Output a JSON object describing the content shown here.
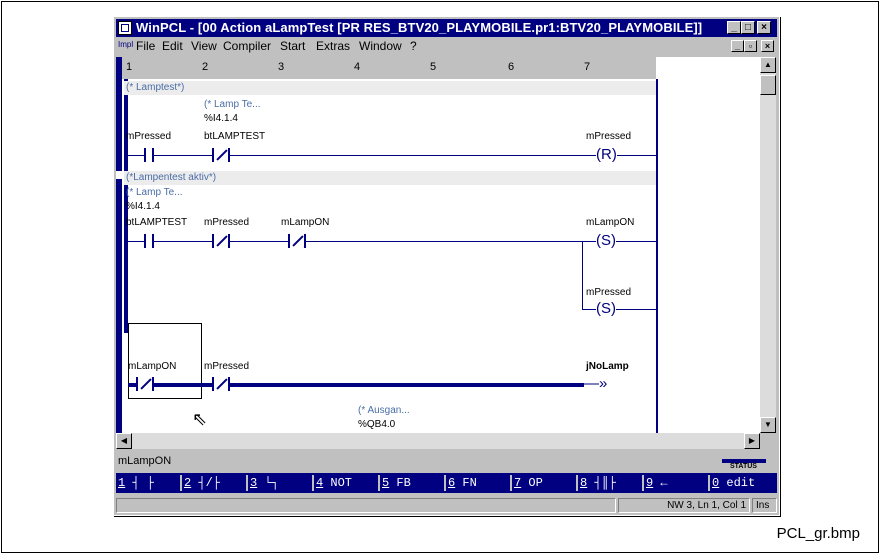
{
  "window": {
    "title": "WinPCL - [00 Action aLampTest [PR RES_BTV20_PLAYMOBILE.pr1:BTV20_PLAYMOBILE]]",
    "caption_buttons": [
      "minimize-icon",
      "maximize-icon",
      "close-icon"
    ]
  },
  "menubar": {
    "impl": "Impl",
    "items": [
      "File",
      "Edit",
      "View",
      "Compiler",
      "Start",
      "Extras",
      "Window",
      "?"
    ]
  },
  "columns": [
    "1",
    "2",
    "3",
    "4",
    "5",
    "6",
    "7"
  ],
  "network": {
    "comment1": "(* Lamptest*)",
    "n1_note": "(* Lamp Te...",
    "n1_addr": "%I4.1.4",
    "n1_c1": "mPressed",
    "n1_c2": "btLAMPTEST",
    "n1_coil": "mPressed",
    "n1_coil_symbol": "(R)",
    "comment2": "(*Lampentest aktiv*)",
    "n2_note": "(* Lamp Te...",
    "n2_addr": "%I4.1.4",
    "n2_c1": "btLAMPTEST",
    "n2_c2": "mPressed",
    "n2_c3": "mLampON",
    "n2_coil1": "mLampON",
    "n2_coil1_symbol": "(S)",
    "n2_coil2": "mPressed",
    "n2_coil2_symbol": "(S)",
    "n3_c1": "mLampON",
    "n3_c2": "mPressed",
    "n3_jump": "jNoLamp",
    "n3_jump_symbol": "—»",
    "n3_note": "(* Ausgan...",
    "n3_addr": "%QB4.0"
  },
  "status": {
    "current_element": "mLampON",
    "widget_label": "STATUS",
    "position": "NW 3, Ln 1, Col 1",
    "mode": "Ins"
  },
  "fkeys": [
    {
      "num": "1",
      "label": " ┤ ├"
    },
    {
      "num": "2",
      "label": " ┤/├"
    },
    {
      "num": "3",
      "label": " └┐"
    },
    {
      "num": "4",
      "label": " NOT"
    },
    {
      "num": "5",
      "label": " FB"
    },
    {
      "num": "6",
      "label": " FN"
    },
    {
      "num": "7",
      "label": " OP"
    },
    {
      "num": "8",
      "label": " ┤║├"
    },
    {
      "num": "9",
      "label": " ←"
    },
    {
      "num": "0",
      "label": " edit"
    }
  ],
  "caption": "PCL_gr.bmp",
  "colors": {
    "titlebar": "#000080",
    "rung": "#000080",
    "comment": "#4a6da7"
  }
}
